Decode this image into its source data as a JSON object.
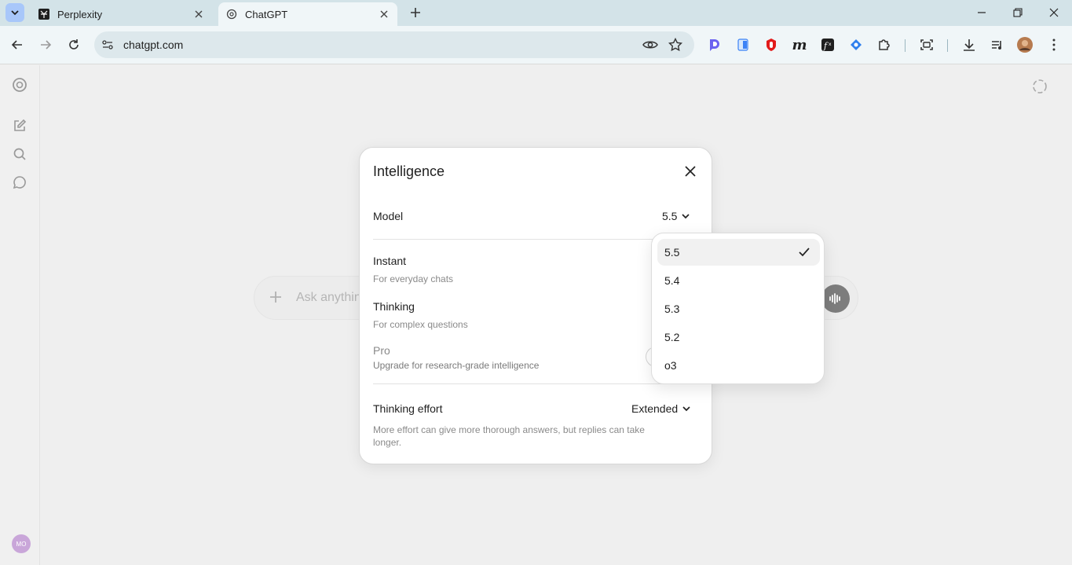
{
  "browser": {
    "tabs": [
      {
        "title": "Perplexity",
        "icon": "perplexity-icon"
      },
      {
        "title": "ChatGPT",
        "icon": "openai-icon"
      }
    ],
    "url": "chatgpt.com"
  },
  "composer": {
    "placeholder": "Ask anythin"
  },
  "dialog": {
    "title": "Intelligence",
    "model_label": "Model",
    "model_value": "5.5",
    "modes": [
      {
        "name": "Instant",
        "desc": "For everyday chats"
      },
      {
        "name": "Thinking",
        "desc": "For complex questions"
      },
      {
        "name": "Pro",
        "desc": "Upgrade for research-grade intelligence"
      }
    ],
    "effort_label": "Thinking effort",
    "effort_value": "Extended",
    "effort_desc": "More effort can give more thorough answers, but replies can take longer."
  },
  "dropdown": {
    "options": [
      "5.5",
      "5.4",
      "5.3",
      "5.2",
      "o3"
    ],
    "selected": "5.5"
  },
  "sidebar": {
    "user_initials": "MO"
  },
  "colors": {
    "tabstrip": "#d3e3e8",
    "toolbar": "#f0f6f8",
    "page": "#efefef",
    "dialog": "#ffffff"
  }
}
